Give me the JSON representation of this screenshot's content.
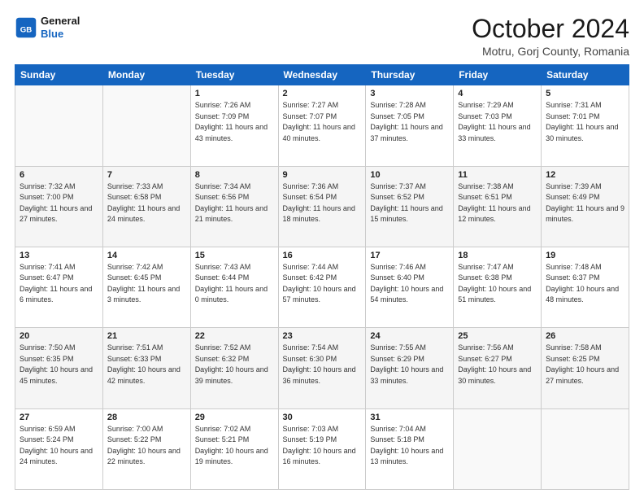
{
  "header": {
    "logo_line1": "General",
    "logo_line2": "Blue",
    "month": "October 2024",
    "location": "Motru, Gorj County, Romania"
  },
  "weekdays": [
    "Sunday",
    "Monday",
    "Tuesday",
    "Wednesday",
    "Thursday",
    "Friday",
    "Saturday"
  ],
  "weeks": [
    [
      {
        "day": "",
        "sunrise": "",
        "sunset": "",
        "daylight": ""
      },
      {
        "day": "",
        "sunrise": "",
        "sunset": "",
        "daylight": ""
      },
      {
        "day": "1",
        "sunrise": "Sunrise: 7:26 AM",
        "sunset": "Sunset: 7:09 PM",
        "daylight": "Daylight: 11 hours and 43 minutes."
      },
      {
        "day": "2",
        "sunrise": "Sunrise: 7:27 AM",
        "sunset": "Sunset: 7:07 PM",
        "daylight": "Daylight: 11 hours and 40 minutes."
      },
      {
        "day": "3",
        "sunrise": "Sunrise: 7:28 AM",
        "sunset": "Sunset: 7:05 PM",
        "daylight": "Daylight: 11 hours and 37 minutes."
      },
      {
        "day": "4",
        "sunrise": "Sunrise: 7:29 AM",
        "sunset": "Sunset: 7:03 PM",
        "daylight": "Daylight: 11 hours and 33 minutes."
      },
      {
        "day": "5",
        "sunrise": "Sunrise: 7:31 AM",
        "sunset": "Sunset: 7:01 PM",
        "daylight": "Daylight: 11 hours and 30 minutes."
      }
    ],
    [
      {
        "day": "6",
        "sunrise": "Sunrise: 7:32 AM",
        "sunset": "Sunset: 7:00 PM",
        "daylight": "Daylight: 11 hours and 27 minutes."
      },
      {
        "day": "7",
        "sunrise": "Sunrise: 7:33 AM",
        "sunset": "Sunset: 6:58 PM",
        "daylight": "Daylight: 11 hours and 24 minutes."
      },
      {
        "day": "8",
        "sunrise": "Sunrise: 7:34 AM",
        "sunset": "Sunset: 6:56 PM",
        "daylight": "Daylight: 11 hours and 21 minutes."
      },
      {
        "day": "9",
        "sunrise": "Sunrise: 7:36 AM",
        "sunset": "Sunset: 6:54 PM",
        "daylight": "Daylight: 11 hours and 18 minutes."
      },
      {
        "day": "10",
        "sunrise": "Sunrise: 7:37 AM",
        "sunset": "Sunset: 6:52 PM",
        "daylight": "Daylight: 11 hours and 15 minutes."
      },
      {
        "day": "11",
        "sunrise": "Sunrise: 7:38 AM",
        "sunset": "Sunset: 6:51 PM",
        "daylight": "Daylight: 11 hours and 12 minutes."
      },
      {
        "day": "12",
        "sunrise": "Sunrise: 7:39 AM",
        "sunset": "Sunset: 6:49 PM",
        "daylight": "Daylight: 11 hours and 9 minutes."
      }
    ],
    [
      {
        "day": "13",
        "sunrise": "Sunrise: 7:41 AM",
        "sunset": "Sunset: 6:47 PM",
        "daylight": "Daylight: 11 hours and 6 minutes."
      },
      {
        "day": "14",
        "sunrise": "Sunrise: 7:42 AM",
        "sunset": "Sunset: 6:45 PM",
        "daylight": "Daylight: 11 hours and 3 minutes."
      },
      {
        "day": "15",
        "sunrise": "Sunrise: 7:43 AM",
        "sunset": "Sunset: 6:44 PM",
        "daylight": "Daylight: 11 hours and 0 minutes."
      },
      {
        "day": "16",
        "sunrise": "Sunrise: 7:44 AM",
        "sunset": "Sunset: 6:42 PM",
        "daylight": "Daylight: 10 hours and 57 minutes."
      },
      {
        "day": "17",
        "sunrise": "Sunrise: 7:46 AM",
        "sunset": "Sunset: 6:40 PM",
        "daylight": "Daylight: 10 hours and 54 minutes."
      },
      {
        "day": "18",
        "sunrise": "Sunrise: 7:47 AM",
        "sunset": "Sunset: 6:38 PM",
        "daylight": "Daylight: 10 hours and 51 minutes."
      },
      {
        "day": "19",
        "sunrise": "Sunrise: 7:48 AM",
        "sunset": "Sunset: 6:37 PM",
        "daylight": "Daylight: 10 hours and 48 minutes."
      }
    ],
    [
      {
        "day": "20",
        "sunrise": "Sunrise: 7:50 AM",
        "sunset": "Sunset: 6:35 PM",
        "daylight": "Daylight: 10 hours and 45 minutes."
      },
      {
        "day": "21",
        "sunrise": "Sunrise: 7:51 AM",
        "sunset": "Sunset: 6:33 PM",
        "daylight": "Daylight: 10 hours and 42 minutes."
      },
      {
        "day": "22",
        "sunrise": "Sunrise: 7:52 AM",
        "sunset": "Sunset: 6:32 PM",
        "daylight": "Daylight: 10 hours and 39 minutes."
      },
      {
        "day": "23",
        "sunrise": "Sunrise: 7:54 AM",
        "sunset": "Sunset: 6:30 PM",
        "daylight": "Daylight: 10 hours and 36 minutes."
      },
      {
        "day": "24",
        "sunrise": "Sunrise: 7:55 AM",
        "sunset": "Sunset: 6:29 PM",
        "daylight": "Daylight: 10 hours and 33 minutes."
      },
      {
        "day": "25",
        "sunrise": "Sunrise: 7:56 AM",
        "sunset": "Sunset: 6:27 PM",
        "daylight": "Daylight: 10 hours and 30 minutes."
      },
      {
        "day": "26",
        "sunrise": "Sunrise: 7:58 AM",
        "sunset": "Sunset: 6:25 PM",
        "daylight": "Daylight: 10 hours and 27 minutes."
      }
    ],
    [
      {
        "day": "27",
        "sunrise": "Sunrise: 6:59 AM",
        "sunset": "Sunset: 5:24 PM",
        "daylight": "Daylight: 10 hours and 24 minutes."
      },
      {
        "day": "28",
        "sunrise": "Sunrise: 7:00 AM",
        "sunset": "Sunset: 5:22 PM",
        "daylight": "Daylight: 10 hours and 22 minutes."
      },
      {
        "day": "29",
        "sunrise": "Sunrise: 7:02 AM",
        "sunset": "Sunset: 5:21 PM",
        "daylight": "Daylight: 10 hours and 19 minutes."
      },
      {
        "day": "30",
        "sunrise": "Sunrise: 7:03 AM",
        "sunset": "Sunset: 5:19 PM",
        "daylight": "Daylight: 10 hours and 16 minutes."
      },
      {
        "day": "31",
        "sunrise": "Sunrise: 7:04 AM",
        "sunset": "Sunset: 5:18 PM",
        "daylight": "Daylight: 10 hours and 13 minutes."
      },
      {
        "day": "",
        "sunrise": "",
        "sunset": "",
        "daylight": ""
      },
      {
        "day": "",
        "sunrise": "",
        "sunset": "",
        "daylight": ""
      }
    ]
  ]
}
